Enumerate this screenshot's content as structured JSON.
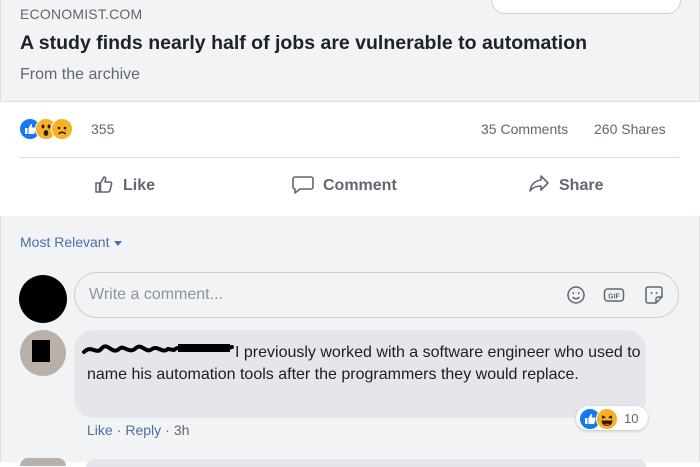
{
  "link_preview": {
    "source": "ECONOMIST.COM",
    "headline": "A study finds nearly half of jobs are vulnerable to automation",
    "subtitle": "From the archive"
  },
  "stats": {
    "reactions_count": "355",
    "reaction_icons": [
      "like-icon",
      "wow-icon",
      "sad-icon"
    ],
    "comments": "35 Comments",
    "shares": "260 Shares"
  },
  "actions": {
    "like": "Like",
    "comment": "Comment",
    "share": "Share"
  },
  "comments": {
    "sort_label": "Most Relevant",
    "input_placeholder": "Write a comment...",
    "items": [
      {
        "author": "",
        "text": "I previously worked with a software engineer who used to name his automation tools after the programmers they would replace.",
        "reaction_count": "10",
        "reaction_icons": [
          "like-icon",
          "haha-icon"
        ],
        "like": "Like",
        "reply": "Reply",
        "time": "3h"
      }
    ]
  },
  "colors": {
    "link_blue": "#4b6ea8",
    "like_blue": "#1877f2",
    "reaction_yellow": "#f7b125",
    "muted_text": "#606770",
    "bubble_bg": "#e4e6eb"
  }
}
